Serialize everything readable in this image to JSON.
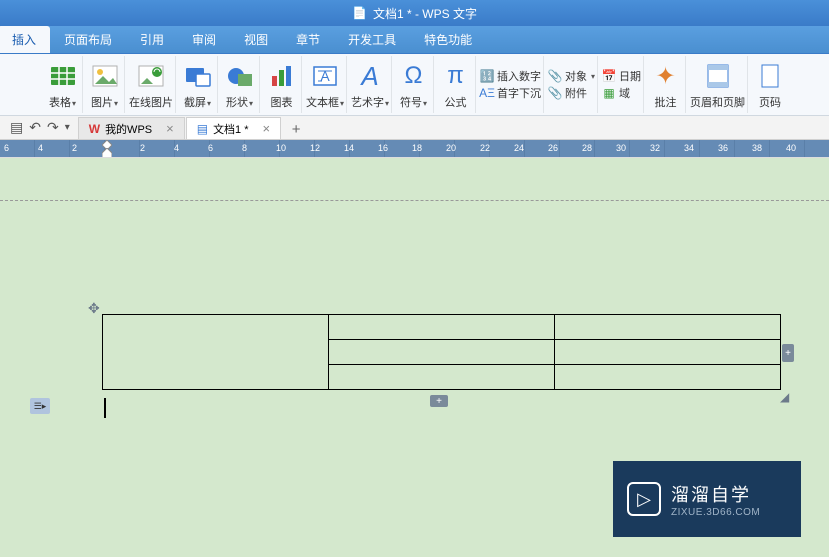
{
  "title": "文档1 * - WPS 文字",
  "menu": {
    "active": "插入",
    "items": [
      "页面布局",
      "引用",
      "审阅",
      "视图",
      "章节",
      "开发工具",
      "特色功能"
    ]
  },
  "ribbon": {
    "items": [
      {
        "label": "表格",
        "icon": "table",
        "color": "#3a9d3a"
      },
      {
        "label": "图片",
        "icon": "image",
        "color": "#e0b050"
      },
      {
        "label": "在线图片",
        "icon": "online-image",
        "color": "#3a9d3a"
      },
      {
        "label": "截屏",
        "icon": "screenshot",
        "color": "#3a7bd5"
      },
      {
        "label": "形状",
        "icon": "shapes",
        "color": "#3a9d3a"
      },
      {
        "label": "图表",
        "icon": "chart",
        "color": "#d64545"
      },
      {
        "label": "文本框",
        "icon": "textbox",
        "color": "#3a7bd5"
      },
      {
        "label": "艺术字",
        "icon": "wordart",
        "color": "#3a7bd5"
      },
      {
        "label": "符号",
        "icon": "omega",
        "color": "#3a7bd5"
      },
      {
        "label": "公式",
        "icon": "pi",
        "color": "#3a7bd5"
      }
    ],
    "small_groups": [
      [
        "插入数字",
        "对象",
        "日期"
      ],
      [
        "首字下沉",
        "附件",
        "域"
      ]
    ],
    "right_items": [
      {
        "label": "批注",
        "icon": "comment"
      },
      {
        "label": "页眉和页脚",
        "icon": "header-footer"
      },
      {
        "label": "页码",
        "icon": "pagenum"
      }
    ]
  },
  "doc_tabs": {
    "tabs": [
      {
        "label": "我的WPS",
        "icon": "W",
        "icon_color": "#d63838"
      },
      {
        "label": "文档1 *",
        "icon": "📄",
        "active": true
      }
    ]
  },
  "ruler_marks": [
    "6",
    "4",
    "2",
    "",
    "2",
    "4",
    "6",
    "8",
    "10",
    "12",
    "14",
    "16",
    "18",
    "20",
    "22",
    "24",
    "26",
    "28",
    "30",
    "32",
    "34",
    "36",
    "38",
    "40"
  ],
  "watermark": {
    "main": "溜溜自学",
    "sub": "ZIXUE.3D66.COM"
  }
}
